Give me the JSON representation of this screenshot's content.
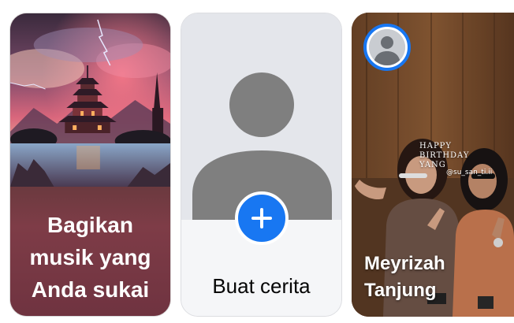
{
  "stories": {
    "music_card": {
      "label_line1": "Bagikan",
      "label_line2": "musik yang",
      "label_line3": "Anda sukai",
      "background_color": "#7e3c47"
    },
    "create_card": {
      "label": "Buat cerita",
      "plus_icon": "plus-icon",
      "accent_color": "#1877f2"
    },
    "friend_card": {
      "name_line1": "Meyrizah",
      "name_line2": "Tanjung",
      "overlay_line1": "HAPPY",
      "overlay_line2": "BIRTHDAY",
      "overlay_line3": "YANG",
      "overlay_tag": "@su_san_ti.ii",
      "ring_color": "#1877f2"
    }
  }
}
